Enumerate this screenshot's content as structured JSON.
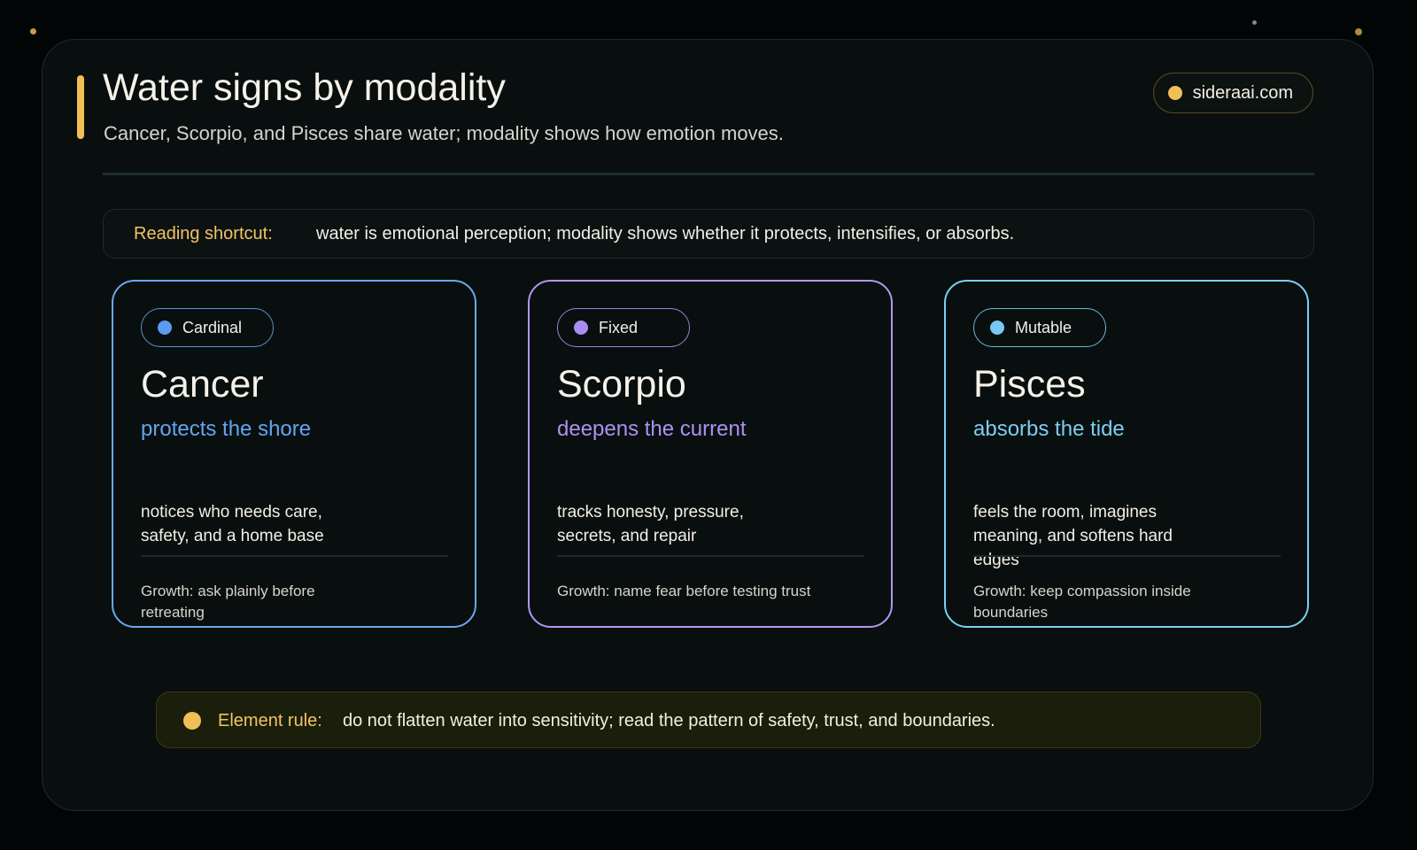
{
  "header": {
    "title": "Water signs by modality",
    "subtitle": "Cancer, Scorpio, and Pisces share water; modality shows how emotion moves.",
    "site": "sideraai.com"
  },
  "shortcut": {
    "label": "Reading shortcut:",
    "text": "water is emotional perception; modality shows whether it protects, intensifies, or absorbs."
  },
  "cards": [
    {
      "modality": "Cardinal",
      "sign": "Cancer",
      "tagline": "protects the shore",
      "trait": "notices who needs care, safety, and a home base",
      "growth": "Growth: ask plainly before retreating",
      "color": "#6aa8f0"
    },
    {
      "modality": "Fixed",
      "sign": "Scorpio",
      "tagline": "deepens the current",
      "trait": "tracks honesty, pressure, secrets, and repair",
      "growth": "Growth: name fear before testing trust",
      "color": "#b197f0"
    },
    {
      "modality": "Mutable",
      "sign": "Pisces",
      "tagline": "absorbs the tide",
      "trait": "feels the room, imagines meaning, and softens hard edges",
      "growth": "Growth: keep compassion inside boundaries",
      "color": "#7bd0f4"
    }
  ],
  "element_rule": {
    "label": "Element rule:",
    "text": "do not flatten water into sensitivity; read the pattern of safety, trust, and boundaries."
  },
  "colors": {
    "background": "#020505",
    "panel": "#090f0e",
    "accent": "#f2bf57"
  }
}
